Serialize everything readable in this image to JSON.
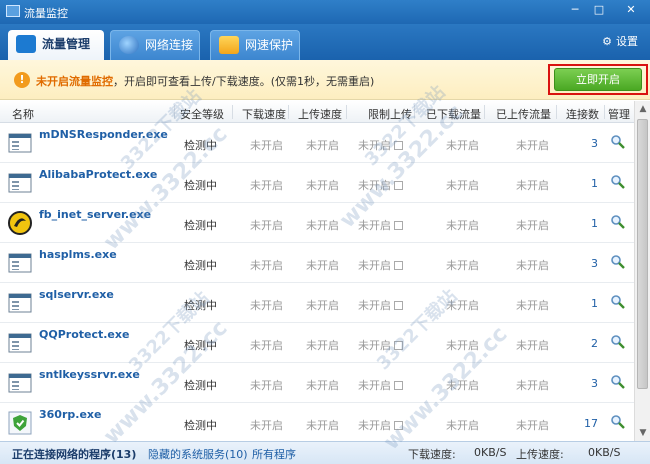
{
  "window": {
    "title": "流量监控",
    "min": "─",
    "max": "□",
    "close": "✕"
  },
  "tabs": [
    {
      "label": "流量管理",
      "icon": "traffic-icon"
    },
    {
      "label": "网络连接",
      "icon": "globe-icon"
    },
    {
      "label": "网速保护",
      "icon": "shield-icon"
    }
  ],
  "settings_label": "设置",
  "notice": {
    "strong": "未开启流量监控",
    "text": "，开启即可查看上传/下载速度。(仅需1秒，无需重启)",
    "button": "立即开启"
  },
  "columns": [
    "名称",
    "安全等级",
    "下载速度",
    "上传速度",
    "限制上传",
    "已下载流量",
    "已上传流量",
    "连接数",
    "管理"
  ],
  "rows": [
    {
      "name": "mDNSResponder.exe",
      "security": "检测中",
      "down": "未开启",
      "up": "未开启",
      "limit": "未开启",
      "downloaded": "未开启",
      "uploaded": "未开启",
      "connections": "3",
      "icon": "app-window-icon"
    },
    {
      "name": "AlibabaProtect.exe",
      "security": "检测中",
      "down": "未开启",
      "up": "未开启",
      "limit": "未开启",
      "downloaded": "未开启",
      "uploaded": "未开启",
      "connections": "1",
      "icon": "app-window-icon"
    },
    {
      "name": "fb_inet_server.exe",
      "security": "检测中",
      "down": "未开启",
      "up": "未开启",
      "limit": "未开启",
      "downloaded": "未开启",
      "uploaded": "未开启",
      "connections": "1",
      "icon": "firebird-icon"
    },
    {
      "name": "hasplms.exe",
      "security": "检测中",
      "down": "未开启",
      "up": "未开启",
      "limit": "未开启",
      "downloaded": "未开启",
      "uploaded": "未开启",
      "connections": "3",
      "icon": "app-window-icon"
    },
    {
      "name": "sqlservr.exe",
      "security": "检测中",
      "down": "未开启",
      "up": "未开启",
      "limit": "未开启",
      "downloaded": "未开启",
      "uploaded": "未开启",
      "connections": "1",
      "icon": "app-window-icon"
    },
    {
      "name": "QQProtect.exe",
      "security": "检测中",
      "down": "未开启",
      "up": "未开启",
      "limit": "未开启",
      "downloaded": "未开启",
      "uploaded": "未开启",
      "connections": "2",
      "icon": "app-window-icon"
    },
    {
      "name": "sntlkeyssrvr.exe",
      "security": "检测中",
      "down": "未开启",
      "up": "未开启",
      "limit": "未开启",
      "downloaded": "未开启",
      "uploaded": "未开启",
      "connections": "3",
      "icon": "app-window-icon"
    },
    {
      "name": "360rp.exe",
      "security": "检测中",
      "down": "未开启",
      "up": "未开启",
      "limit": "未开启",
      "downloaded": "未开启",
      "uploaded": "未开启",
      "connections": "17",
      "icon": "360-shield-icon"
    }
  ],
  "footer": {
    "active": "正在连接网络的程序(13)",
    "hidden": "隐藏的系统服务(10)",
    "all": "所有程序",
    "down_label": "下载速度:",
    "down_value": "0KB/S",
    "up_label": "上传速度:",
    "up_value": "0KB/S"
  },
  "watermark": "www.3322.cc",
  "watermark_cn": "3322下载站",
  "colors": {
    "accent": "#1f5fa6",
    "warning": "#e06b00",
    "start_button": "#4aa823",
    "highlight_box": "#d9120f"
  }
}
